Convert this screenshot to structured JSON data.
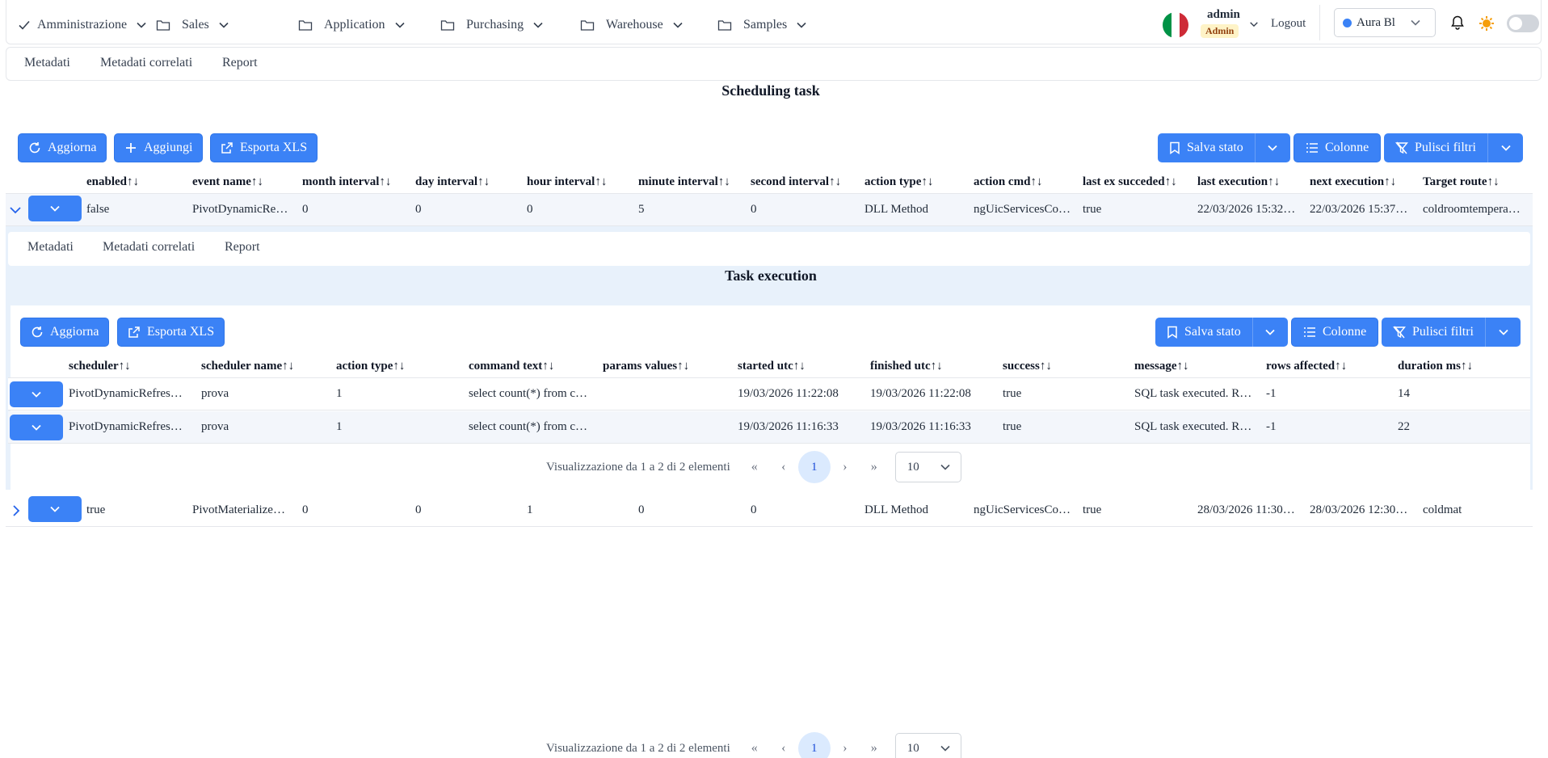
{
  "menu": {
    "items": [
      {
        "label": "Amministrazione"
      },
      {
        "label": "Sales"
      },
      {
        "label": "Application"
      },
      {
        "label": "Purchasing"
      },
      {
        "label": "Warehouse"
      },
      {
        "label": "Samples"
      }
    ],
    "user": {
      "name": "admin",
      "role": "Admin"
    },
    "logout": "Logout",
    "theme": "Aura Bl"
  },
  "tabs": [
    "Metadati",
    "Metadati correlati",
    "Report"
  ],
  "main": {
    "title": "Scheduling task",
    "buttons": {
      "refresh": "Aggiorna",
      "add": "Aggiungi",
      "export": "Esporta XLS",
      "save_state": "Salva stato",
      "columns": "Colonne",
      "clear_filters": "Pulisci filtri"
    },
    "columns": [
      "enabled",
      "event name",
      "month interval",
      "day interval",
      "hour interval",
      "minute interval",
      "second interval",
      "action type",
      "action cmd",
      "last ex succeded",
      "last execution",
      "next execution",
      "Target route"
    ],
    "rows": [
      [
        "false",
        "PivotDynamicRe…",
        "0",
        "0",
        "0",
        "5",
        "0",
        "DLL Method",
        "ngUicServicesCo…",
        "true",
        "22/03/2026 15:32…",
        "22/03/2026 15:37…",
        "coldroomtempera…"
      ],
      [
        "true",
        "PivotMaterialize…",
        "0",
        "0",
        "1",
        "0",
        "0",
        "DLL Method",
        "ngUicServicesCo…",
        "true",
        "28/03/2026 11:30…",
        "28/03/2026 12:30…",
        "coldmat"
      ]
    ],
    "pager": {
      "summary": "Visualizzazione da 1 a 2 di 2 elementi",
      "page": "1",
      "page_size": "10"
    }
  },
  "sub": {
    "title": "Task execution",
    "buttons": {
      "refresh": "Aggiorna",
      "export": "Esporta XLS",
      "save_state": "Salva stato",
      "columns": "Colonne",
      "clear_filters": "Pulisci filtri"
    },
    "columns": [
      "scheduler",
      "scheduler name",
      "action type",
      "command text",
      "params values",
      "started utc",
      "finished utc",
      "success",
      "message",
      "rows affected",
      "duration ms"
    ],
    "rows": [
      [
        "PivotDynamicRefres…",
        "prova",
        "1",
        "select count(*) from c…",
        "",
        "19/03/2026 11:22:08",
        "19/03/2026 11:22:08",
        "true",
        "SQL task executed. R…",
        "-1",
        "14"
      ],
      [
        "PivotDynamicRefres…",
        "prova",
        "1",
        "select count(*) from c…",
        "",
        "19/03/2026 11:16:33",
        "19/03/2026 11:16:33",
        "true",
        "SQL task executed. R…",
        "-1",
        "22"
      ]
    ],
    "pager": {
      "summary": "Visualizzazione da 1 a 2 di 2 elementi",
      "page": "1",
      "page_size": "10"
    }
  },
  "sort_glyph": "↑↓",
  "colors": {
    "primary": "#3b82f6",
    "row_alt": "#f3f6fb",
    "subpanel": "#e8f1fb"
  }
}
